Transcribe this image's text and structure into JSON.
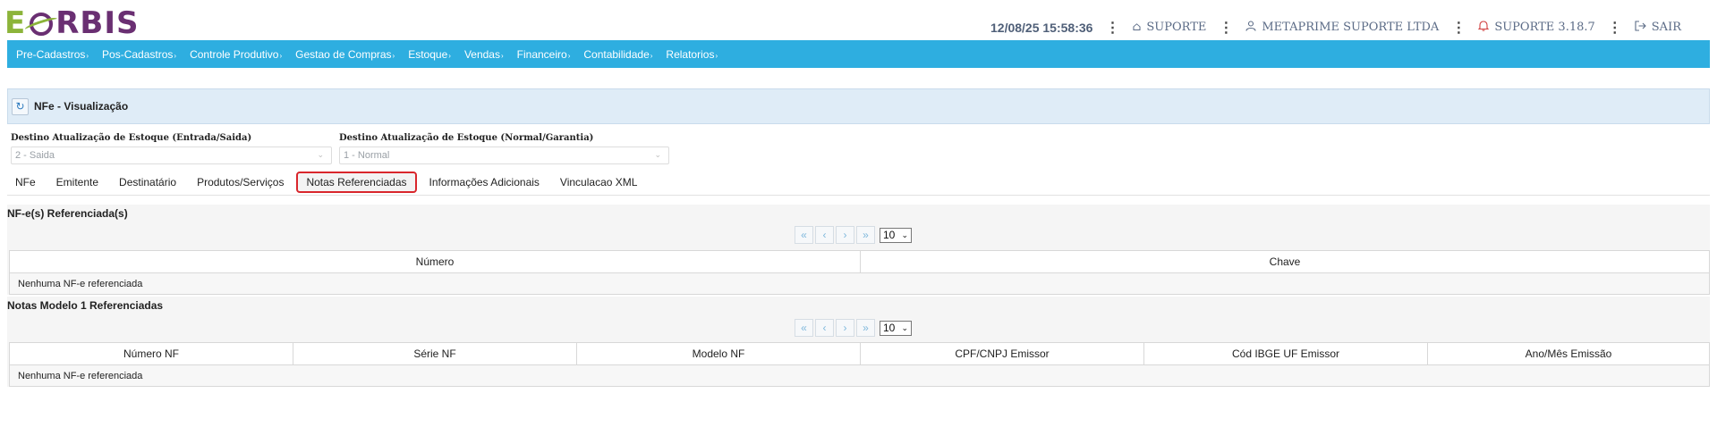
{
  "brand": {
    "logo_e": "E",
    "logo_rest": "RBIS"
  },
  "header": {
    "datetime": "12/08/25 15:58:36",
    "home_label": "SUPORTE",
    "company_label": "METAPRIME SUPORTE LTDA",
    "version_label": "SUPORTE 3.18.7",
    "logout_label": "SAIR"
  },
  "menu": [
    {
      "label": "Pre-Cadastros"
    },
    {
      "label": "Pos-Cadastros"
    },
    {
      "label": "Controle Produtivo"
    },
    {
      "label": "Gestao de Compras"
    },
    {
      "label": "Estoque"
    },
    {
      "label": "Vendas"
    },
    {
      "label": "Financeiro"
    },
    {
      "label": "Contabilidade"
    },
    {
      "label": "Relatorios"
    }
  ],
  "page": {
    "title": "NFe - Visualização"
  },
  "filters": {
    "destino_entrada_saida": {
      "label": "Destino Atualização de Estoque (Entrada/Saida)",
      "value": "2 - Saida"
    },
    "destino_normal_garantia": {
      "label": "Destino Atualização de Estoque (Normal/Garantia)",
      "value": "1 - Normal"
    }
  },
  "tabs": [
    {
      "label": "NFe"
    },
    {
      "label": "Emitente"
    },
    {
      "label": "Destinatário"
    },
    {
      "label": "Produtos/Serviços"
    },
    {
      "label": "Notas Referenciadas",
      "active": true
    },
    {
      "label": "Informações Adicionais"
    },
    {
      "label": "Vinculacao XML"
    }
  ],
  "nfe_refs": {
    "title": "NF-e(s) Referenciada(s)",
    "page_size": "10",
    "columns": [
      "Número",
      "Chave"
    ],
    "empty_message": "Nenhuma NF-e referenciada"
  },
  "modelo1_refs": {
    "title": "Notas Modelo 1 Referenciadas",
    "page_size": "10",
    "columns": [
      "Número NF",
      "Série NF",
      "Modelo NF",
      "CPF/CNPJ Emissor",
      "Cód IBGE UF Emissor",
      "Ano/Mês Emissão"
    ],
    "empty_message": "Nenhuma NF-e referenciada"
  },
  "pager_glyphs": {
    "first": "«",
    "prev": "‹",
    "next": "›",
    "last": "»"
  },
  "colors": {
    "menu_bg": "#2eaee0",
    "panel_bg": "#dfecf7",
    "active_tab_border": "#d9262c",
    "logo_green": "#8cb43a",
    "logo_purple": "#6a2f72"
  },
  "icons": {
    "refresh": "refresh-icon",
    "home": "home-icon",
    "user": "user-icon",
    "bell": "bell-icon",
    "logout": "logout-icon",
    "kebab": "kebab-menu-icon"
  }
}
